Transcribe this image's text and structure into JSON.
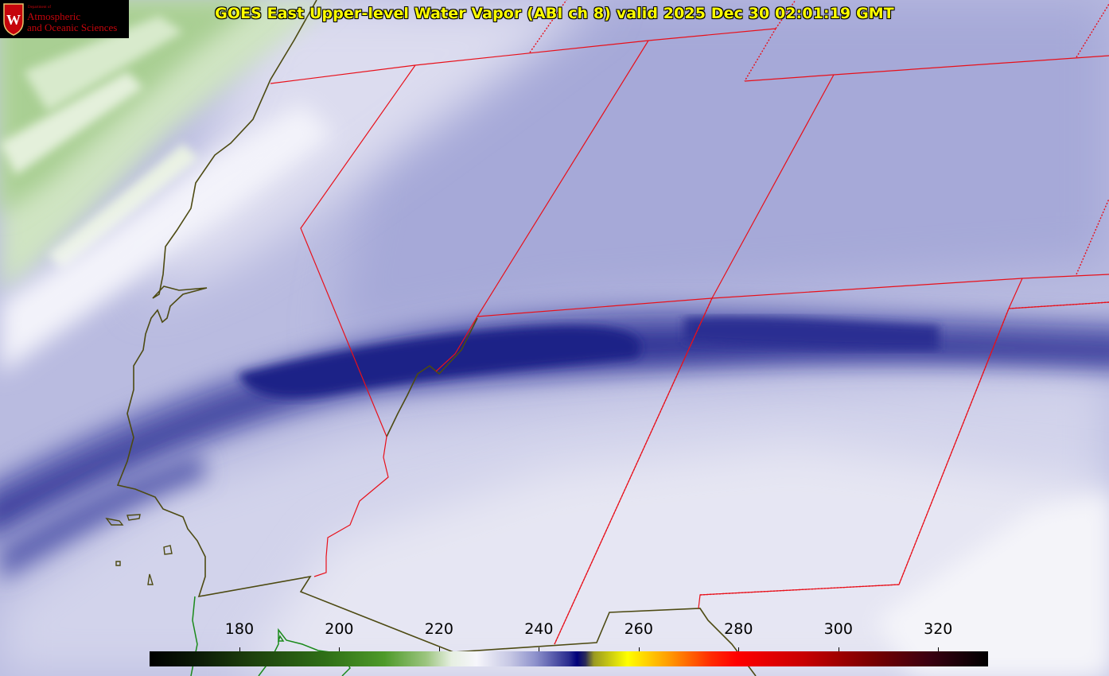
{
  "title": "GOES East Upper-level Water Vapor (ABI ch 8) valid 2025 Dec 30 02:01:19 GMT",
  "logo": {
    "dept": "Department of",
    "line1": "Atmospheric",
    "line2": "and Oceanic Sciences",
    "crest_letter": "W"
  },
  "colorbar": {
    "ticks": [
      "180",
      "200",
      "220",
      "240",
      "260",
      "280",
      "300",
      "320"
    ],
    "tick_values": [
      180,
      200,
      220,
      240,
      260,
      280,
      300,
      320
    ],
    "range": [
      162,
      330
    ]
  },
  "colors": {
    "border_red": "#e8101a",
    "coast": "#4d4a12",
    "green_coast": "#1a8a1a"
  }
}
